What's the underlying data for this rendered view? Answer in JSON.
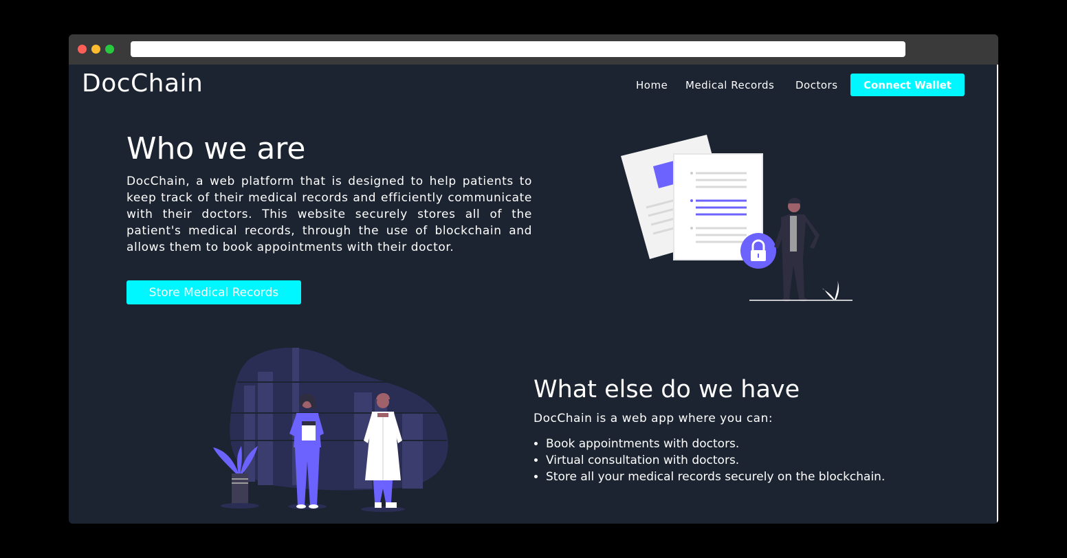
{
  "app": {
    "brand": "DocChain",
    "url": ""
  },
  "nav": {
    "items": [
      {
        "label": "Home"
      },
      {
        "label": "Medical Records"
      },
      {
        "label": "Doctors"
      }
    ],
    "cta_label": "Connect Wallet"
  },
  "hero": {
    "title": "Who we are",
    "description": "DocChain, a web platform that is designed to help patients to keep track of their medical records and efficiently communicate with their doctors. This website securely stores all of the patient's medical records, through the use of blockchain and allows them to book appointments with their doctor.",
    "button_label": "Store Medical Records",
    "illustration": "document-lock-person-illustration"
  },
  "features": {
    "title": "What else do we have",
    "intro": "DocChain is a web app where you can:",
    "items": [
      "Book appointments with doctors.",
      "Virtual consultation with doctors.",
      "Store all your medical records securely on the blockchain."
    ],
    "illustration": "doctors-illustration"
  },
  "colors": {
    "background": "#1c2331",
    "accent": "#00f7ff",
    "illustration_purple": "#6c63ff",
    "chrome": "#3a3a3a"
  }
}
